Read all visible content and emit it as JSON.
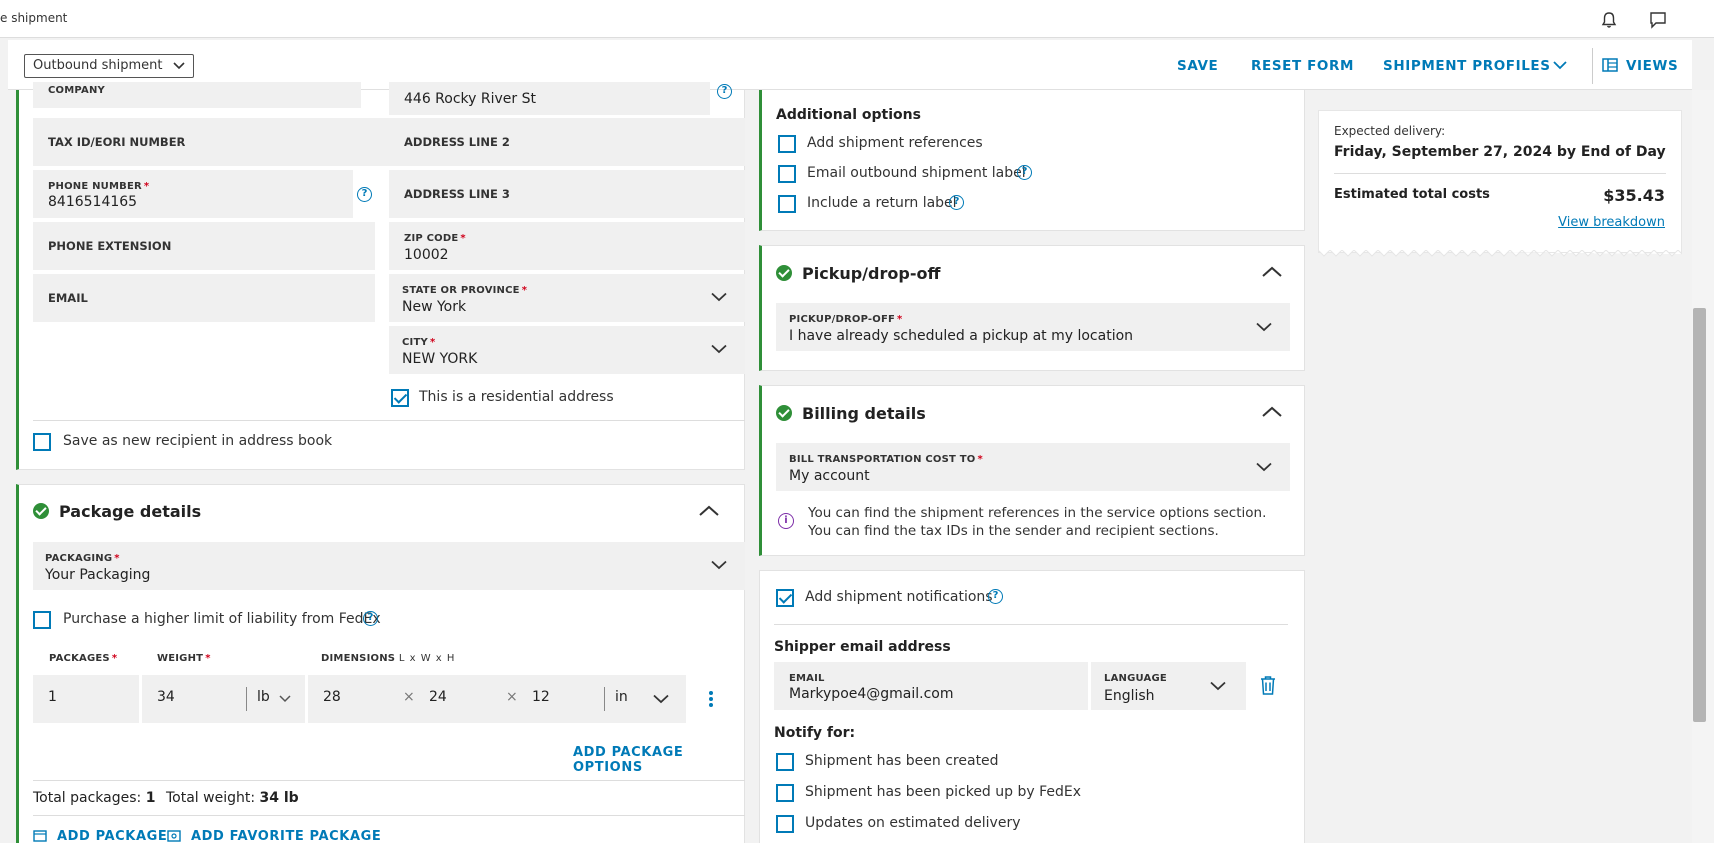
{
  "app": {
    "title": "e shipment"
  },
  "toolbar": {
    "shipment_type": "Outbound shipment",
    "save": "SAVE",
    "reset": "RESET FORM",
    "profiles": "SHIPMENT PROFILES",
    "views": "VIEWS"
  },
  "recipient": {
    "company_label": "COMPANY",
    "address1_value": "446 Rocky River St",
    "tax_label": "TAX ID/EORI NUMBER",
    "address2_label": "ADDRESS LINE 2",
    "phone_label": "PHONE NUMBER",
    "phone_value": "8416514165",
    "address3_label": "ADDRESS LINE 3",
    "ext_label": "PHONE EXTENSION",
    "zip_label": "ZIP CODE",
    "zip_value": "10002",
    "email_label": "EMAIL",
    "state_label": "STATE OR PROVINCE",
    "state_value": "New York",
    "city_label": "CITY",
    "city_value": "NEW YORK",
    "residential": "This is a residential address",
    "save_recipient": "Save as new recipient in address book"
  },
  "package": {
    "title": "Package details",
    "packaging_label": "PACKAGING",
    "packaging_value": "Your Packaging",
    "liability": "Purchase a higher limit of liability from FedEx",
    "packages_label": "PACKAGES",
    "weight_label": "WEIGHT",
    "dimensions_label": "DIMENSIONS",
    "dimensions_hint": "L x W x H",
    "packages_value": "1",
    "weight_value": "34",
    "weight_unit": "lb",
    "dim_l": "28",
    "dim_w": "24",
    "dim_h": "12",
    "dim_unit": "in",
    "times": "×",
    "add_options": "ADD PACKAGE OPTIONS",
    "total_packages_label": "Total packages:",
    "total_packages_value": "1",
    "total_weight_label": "Total weight:",
    "total_weight_value": "34 lb",
    "add_package": "ADD PACKAGE",
    "add_favorite": "ADD FAVORITE PACKAGE"
  },
  "options": {
    "title": "Additional options",
    "refs": "Add shipment references",
    "email_label": "Email outbound shipment label",
    "return_label": "Include a return label"
  },
  "pickup": {
    "title": "Pickup/drop-off",
    "label": "PICKUP/DROP-OFF",
    "value": "I have already scheduled a pickup at my location"
  },
  "billing": {
    "title": "Billing details",
    "label": "BILL TRANSPORTATION COST TO",
    "value": "My account",
    "info": "You can find the shipment references in the service options section. You can find the tax IDs in the sender and recipient sections."
  },
  "notifications": {
    "add": "Add shipment notifications",
    "shipper_email_title": "Shipper email address",
    "email_label": "EMAIL",
    "email_value": "Markypoe4@gmail.com",
    "language_label": "LANGUAGE",
    "language_value": "English",
    "notify_for": "Notify for:",
    "created": "Shipment has been created",
    "picked_up": "Shipment has been picked up by FedEx",
    "estimated": "Updates on estimated delivery"
  },
  "summary": {
    "expected_label": "Expected delivery:",
    "expected_value": "Friday, September 27, 2024 by End of Day",
    "cost_label": "Estimated total costs",
    "cost_value": "$35.43",
    "breakdown": "View breakdown"
  },
  "colors": {
    "accent": "#007ab7",
    "success": "#2f8f38",
    "required": "#d0021b"
  }
}
